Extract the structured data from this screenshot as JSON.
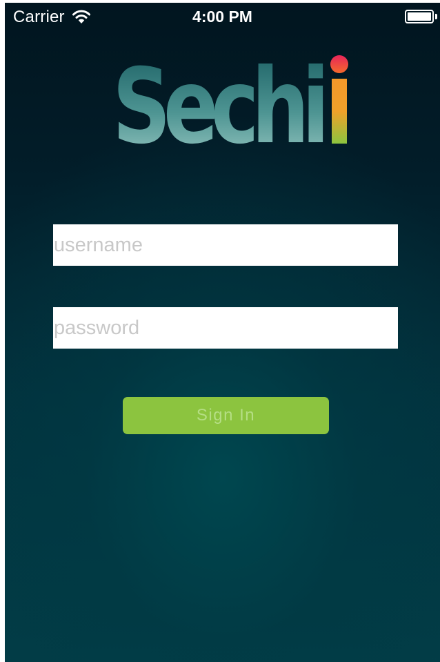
{
  "status_bar": {
    "carrier": "Carrier",
    "time": "4:00 PM",
    "wifi_icon": "wifi-icon",
    "battery_icon": "battery-icon"
  },
  "logo": {
    "text": "Sechi"
  },
  "login": {
    "username": {
      "value": "",
      "placeholder": "username"
    },
    "password": {
      "value": "",
      "placeholder": "password"
    },
    "sign_in_label": "Sign In"
  },
  "colors": {
    "background_top": "#01151f",
    "background_bottom": "#023d47",
    "button": "#8cc43f",
    "button_text": "#b5de84",
    "logo_teal": "#1e6e6e",
    "logo_dot": "#e0285a",
    "logo_i_orange": "#f39a22",
    "logo_i_green": "#8cc43f"
  }
}
